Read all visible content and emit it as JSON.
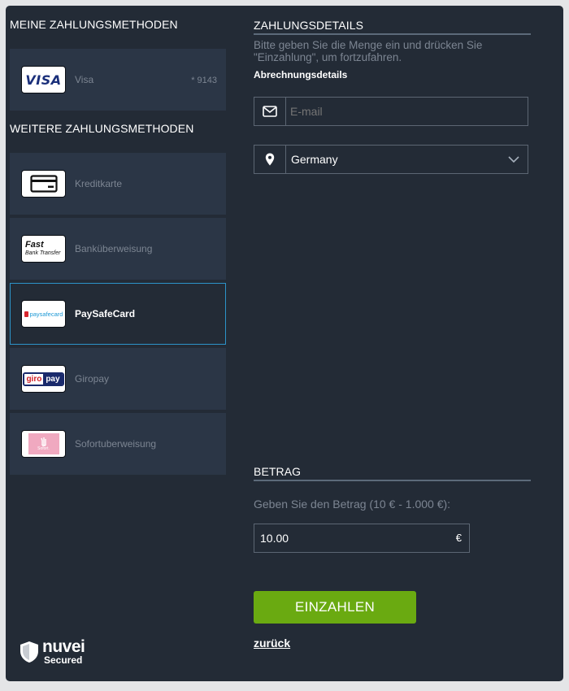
{
  "left": {
    "my_methods_title": "MEINE ZAHLUNGSMETHODEN",
    "saved": {
      "label": "Visa",
      "masked": "* 9143",
      "logo_text": "VISA"
    },
    "other_methods_title": "WEITERE ZAHLUNGSMETHODEN",
    "methods": [
      {
        "label": "Kreditkarte",
        "icon": "credit-card-icon"
      },
      {
        "label": "Banküberweisung",
        "icon": "fast-bank-transfer-logo",
        "logo_line1": "Fast",
        "logo_line2": "Bank Transfer"
      },
      {
        "label": "PaySafeCard",
        "icon": "paysafecard-logo",
        "logo_text": "paysafecard",
        "selected": true
      },
      {
        "label": "Giropay",
        "icon": "giropay-logo",
        "logo_text_a": "giro",
        "logo_text_b": "pay"
      },
      {
        "label": "Sofortuberweisung",
        "icon": "sofort-logo",
        "logo_text": "Sofort."
      }
    ],
    "badge": {
      "brand": "nuvei",
      "sub": "Secured"
    }
  },
  "details": {
    "title": "ZAHLUNGSDETAILS",
    "instructions": "Bitte geben Sie die Menge ein und drücken Sie \"Einzahlung\", um fortzufahren.",
    "billing_label": "Abrechnungsdetails",
    "email_placeholder": "E-mail",
    "country": "Germany"
  },
  "amount": {
    "title": "BETRAG",
    "prompt": "Geben Sie den Betrag (10 € - 1.000 €):",
    "value": "10.00",
    "currency": "€"
  },
  "actions": {
    "deposit": "EINZAHLEN",
    "back": "zurück"
  },
  "colors": {
    "panel": "#232b36",
    "card": "#2b3646",
    "accent_border": "#2c93c9",
    "button": "#6aaa11",
    "muted_text": "#7c8592",
    "field_border": "#5c6673"
  }
}
